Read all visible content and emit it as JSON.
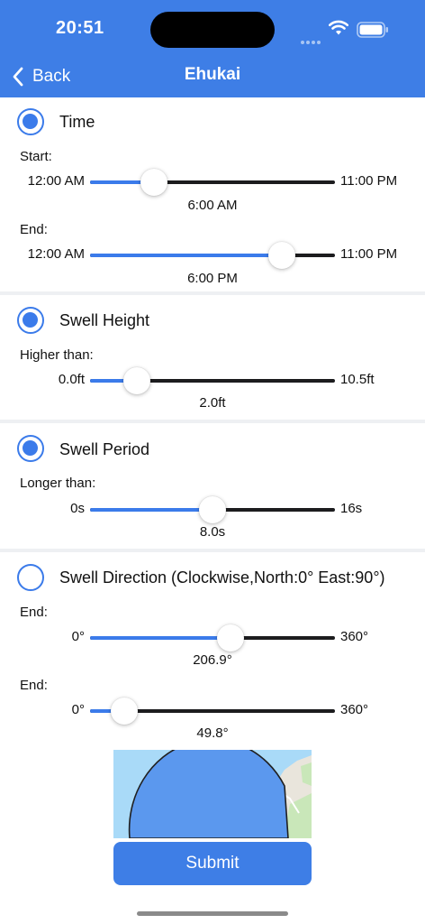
{
  "status_bar": {
    "time": "20:51"
  },
  "nav": {
    "back_label": "Back",
    "title": "Ehukai"
  },
  "time_section": {
    "title": "Time",
    "checked": true,
    "start": {
      "label": "Start:",
      "min_label": "12:00 AM",
      "max_label": "11:00 PM",
      "value_label": "6:00 AM",
      "value": 6,
      "min": 0,
      "max": 23
    },
    "end": {
      "label": "End:",
      "min_label": "12:00 AM",
      "max_label": "11:00 PM",
      "value_label": "6:00 PM",
      "value": 18,
      "min": 0,
      "max": 23
    }
  },
  "swell_height": {
    "title": "Swell Height",
    "checked": true,
    "label": "Higher than:",
    "min_label": "0.0ft",
    "max_label": "10.5ft",
    "value_label": "2.0ft",
    "value": 2.0,
    "min": 0,
    "max": 10.5
  },
  "swell_period": {
    "title": "Swell Period",
    "checked": true,
    "label": "Longer than:",
    "min_label": "0s",
    "max_label": "16s",
    "value_label": "8.0s",
    "value": 8,
    "min": 0,
    "max": 16
  },
  "swell_direction": {
    "title": "Swell Direction (Clockwise,North:0° East:90°)",
    "checked": false,
    "first": {
      "label": "End:",
      "min_label": "0°",
      "max_label": "360°",
      "value_label": "206.9°",
      "value": 206.9,
      "min": 0,
      "max": 360
    },
    "second": {
      "label": "End:",
      "min_label": "0°",
      "max_label": "360°",
      "value_label": "49.8°",
      "value": 49.8,
      "min": 0,
      "max": 360
    }
  },
  "submit_label": "Submit",
  "colors": {
    "accent": "#3e7ee6",
    "track": "#1c1c1e",
    "divider": "#eef0f3"
  }
}
